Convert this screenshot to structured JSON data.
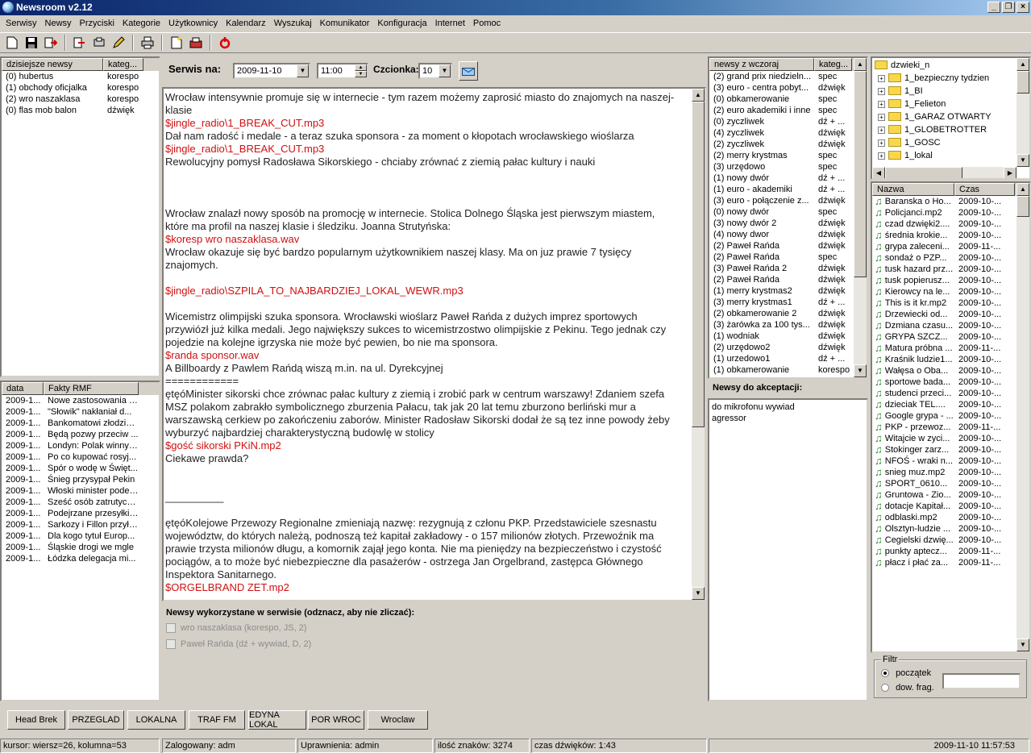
{
  "window": {
    "title": "Newsroom v2.12"
  },
  "menu": [
    "Serwisy",
    "Newsy",
    "Przyciski",
    "Kategorie",
    "Użytkownicy",
    "Kalendarz",
    "Wyszukaj",
    "Komunikator",
    "Konfiguracja",
    "Internet",
    "Pomoc"
  ],
  "today_news": {
    "headers": [
      "dzisiejsze newsy",
      "kateg..."
    ],
    "rows": [
      [
        "(0) hubertus",
        "korespo"
      ],
      [
        "(1) obchody oficjalka",
        "korespo"
      ],
      [
        "(2) wro naszaklasa",
        "korespo"
      ],
      [
        "(0) flas mob balon",
        "dźwięk"
      ]
    ]
  },
  "facts": {
    "headers": [
      "data",
      "Fakty RMF"
    ],
    "rows": [
      [
        "2009-1...",
        "Nowe zastosowania s..."
      ],
      [
        "2009-1...",
        "\"Słowik\" nakłaniał d..."
      ],
      [
        "2009-1...",
        "Bankomatowi złodziej..."
      ],
      [
        "2009-1...",
        "Będą pozwy przeciw ..."
      ],
      [
        "2009-1...",
        "Londyn: Polak winny ..."
      ],
      [
        "2009-1...",
        "Po co kupować rosyj..."
      ],
      [
        "2009-1...",
        "Spór o wodę w Święt..."
      ],
      [
        "2009-1...",
        "Śnieg przysypał Pekin"
      ],
      [
        "2009-1...",
        "Włoski minister podej..."
      ],
      [
        "2009-1...",
        "Sześć osób zatrutych..."
      ],
      [
        "2009-1...",
        "Podejrzane przesyłki ..."
      ],
      [
        "2009-1...",
        "Sarkozy i Fillon przyła..."
      ],
      [
        "2009-1...",
        "Dla kogo tytuł Europ..."
      ],
      [
        "2009-1...",
        "Śląskie drogi we mgle"
      ],
      [
        "2009-1...",
        "Łódzka delegacja mi..."
      ]
    ]
  },
  "service": {
    "label": "Serwis na:",
    "date": "2009-11-10",
    "time": "11:00",
    "font_label": "Czcionka:",
    "font_size": "10"
  },
  "editor_lines": [
    {
      "t": "Wrocław intensywnie promuje się w internecie - tym razem możemy zaprosić miasto do znajomych na naszej-",
      "red": false
    },
    {
      "t": "klasie",
      "red": false
    },
    {
      "t": "$jingle_radio\\1_BREAK_CUT.mp3",
      "red": true
    },
    {
      "t": "Dał nam radość i medale - a teraz szuka sponsora - za moment o kłopotach wrocławskiego wioślarza",
      "red": false
    },
    {
      "t": "$jingle_radio\\1_BREAK_CUT.mp3",
      "red": true
    },
    {
      "t": "Rewolucyjny pomysł Radosława Sikorskiego - chciaby zrównać z ziemią pałac kultury i nauki",
      "red": false
    },
    {
      "t": "",
      "red": false
    },
    {
      "t": "",
      "red": false
    },
    {
      "t": "",
      "red": false
    },
    {
      "t": "Wrocław znalazł nowy sposób na promocję w internecie. Stolica Dolnego Śląska jest pierwszym miastem,",
      "red": false
    },
    {
      "t": "które ma profil na naszej klasie i śledziku. Joanna Strutyńska:",
      "red": false
    },
    {
      "t": "$koresp wro naszaklasa.wav",
      "red": true
    },
    {
      "t": "Wrocław okazuje się być bardzo popularnym użytkownikiem naszej klasy. Ma on juz prawie 7 tysięcy",
      "red": false
    },
    {
      "t": "znajomych.",
      "red": false
    },
    {
      "t": "",
      "red": false
    },
    {
      "t": "$jingle_radio\\SZPILA_TO_NAJBARDZIEJ_LOKAL_WEWR.mp3",
      "red": true
    },
    {
      "t": "",
      "red": false
    },
    {
      "t": "Wicemistrz olimpijski szuka sponsora. Wrocławski wioślarz Paweł Rańda z dużych imprez sportowych",
      "red": false
    },
    {
      "t": "przywiózł już kilka medali. Jego największy sukces to wicemistrzostwo olimpijskie z Pekinu. Tego jednak czy",
      "red": false
    },
    {
      "t": "pojedzie na kolejne igrzyska nie może być pewien, bo nie ma sponsora.",
      "red": false
    },
    {
      "t": "$randa sponsor.wav",
      "red": true
    },
    {
      "t": "A Billboardy z Pawlem Rańdą wiszą m.in. na ul. Dyrekcyjnej",
      "red": false
    },
    {
      "t": "============",
      "red": false
    },
    {
      "t": "ętęóMinister sikorski chce zrównac pałac kultury z ziemią i zrobić park w centrum warszawy! Zdaniem szefa",
      "red": false
    },
    {
      "t": "MSZ polakom zabrakło symbolicznego zburzenia Pałacu, tak jak 20 lat temu zburzono berliński mur a",
      "red": false
    },
    {
      "t": "warszawską cerkiew po zakończeniu zaborów. Minister Radosław Sikorski dodał że są tez inne powody żeby",
      "red": false
    },
    {
      "t": "wyburzyć najbardziej charakterystyczną budowlę w stolicy",
      "red": false
    },
    {
      "t": "$gość sikorski PKiN.mp2",
      "red": true
    },
    {
      "t": "Ciekawe prawda?",
      "red": false
    },
    {
      "t": "",
      "red": false
    },
    {
      "t": "",
      "red": false
    },
    {
      "t": "__________",
      "red": false
    },
    {
      "t": "",
      "red": false
    },
    {
      "t": "ętęóKolejowe Przewozy Regionalne zmieniają nazwę: rezygnują z członu PKP. Przedstawiciele szesnastu",
      "red": false
    },
    {
      "t": "województw, do których należą, podnoszą też kapitał zakładowy - o 157 milionów złotych. Przewoźnik ma",
      "red": false
    },
    {
      "t": "prawie trzysta milionów długu, a komornik zajął jego konta. Nie ma pieniędzy na bezpieczeństwo i czystość",
      "red": false
    },
    {
      "t": "pociągów, a to może być niebezpieczne dla pasażerów - ostrzega Jan Orgelbrand, zastępca Głównego",
      "red": false
    },
    {
      "t": "Inspektora Sanitarnego.",
      "red": false
    },
    {
      "t": "$ORGELBRAND ZET.mp2",
      "red": true
    }
  ],
  "used_news": {
    "title": "Newsy wykorzystane w serwisie (odznacz, aby nie zliczać):",
    "items": [
      "wro naszaklasa (korespo, JS, 2)",
      "Paweł Rańda (dź + wywiad, D, 2)"
    ]
  },
  "yesterday": {
    "headers": [
      "newsy z wczoraj",
      "kateg..."
    ],
    "rows": [
      [
        "(2) grand prix niedzieln...",
        "spec"
      ],
      [
        "(3) euro - centra pobyt...",
        "dźwięk"
      ],
      [
        "(0) obkamerowanie",
        "spec"
      ],
      [
        "(2) euro akademiki i inne",
        "spec"
      ],
      [
        "(0) zyczliwek",
        "dź + ..."
      ],
      [
        "(4) zyczliwek",
        "dźwięk"
      ],
      [
        "(2) zyczliwek",
        "dźwięk"
      ],
      [
        "(2) merry krystmas",
        "spec"
      ],
      [
        "(3) urzędowo",
        "spec"
      ],
      [
        "(1) nowy dwór",
        "dź + ..."
      ],
      [
        "(1) euro - akademiki",
        "dź + ..."
      ],
      [
        "(3) euro - połączenie z...",
        "dźwięk"
      ],
      [
        "(0) nowy dwór",
        "spec"
      ],
      [
        "(3) nowy dwór 2",
        "dźwięk"
      ],
      [
        "(4) nowy dwor",
        "dźwięk"
      ],
      [
        "(2) Paweł Rańda",
        "dźwięk"
      ],
      [
        "(2) Paweł Rańda",
        "spec"
      ],
      [
        "(3) Paweł Rańda 2",
        "dźwięk"
      ],
      [
        "(2) Paweł Rańda",
        "dźwięk"
      ],
      [
        "(1) merry krystmas2",
        "dźwięk"
      ],
      [
        "(3) merry krystmas1",
        "dź + ..."
      ],
      [
        "(2) obkamerowanie 2",
        "dźwięk"
      ],
      [
        "(3) żarówka za 100 tys...",
        "dźwięk"
      ],
      [
        "(1) wodniak",
        "dźwięk"
      ],
      [
        "(2) urzędowo2",
        "dźwięk"
      ],
      [
        "(1) urzedowo1",
        "dź + ..."
      ],
      [
        "(1) obkamerowanie",
        "korespo"
      ]
    ]
  },
  "pending": {
    "title": "Newsy do akceptacji:",
    "items": [
      "do mikrofonu wywiad",
      "agressor"
    ]
  },
  "tree": {
    "root": "dzwieki_n",
    "items": [
      "1_bezpieczny tydzien",
      "1_BI",
      "1_Felieton",
      "1_GARAZ OTWARTY",
      "1_GLOBETROTTER",
      "1_GOSC",
      "1_lokal"
    ]
  },
  "files": {
    "headers": [
      "Nazwa",
      "Czas"
    ],
    "rows": [
      [
        "Baranska o Ho...",
        "2009-10-..."
      ],
      [
        "Policjanci.mp2",
        "2009-10-..."
      ],
      [
        "czad dzwięki2....",
        "2009-10-..."
      ],
      [
        "średnia krokie...",
        "2009-10-..."
      ],
      [
        "grypa zaleceni...",
        "2009-11-..."
      ],
      [
        "sondaż o PZP...",
        "2009-10-..."
      ],
      [
        "tusk hazard prz...",
        "2009-10-..."
      ],
      [
        "tusk popierusz...",
        "2009-10-..."
      ],
      [
        "Kierowcy na le...",
        "2009-10-..."
      ],
      [
        "This is it kr.mp2",
        "2009-10-..."
      ],
      [
        "Drzewiecki od...",
        "2009-10-..."
      ],
      [
        "Dzmiana czasu...",
        "2009-10-..."
      ],
      [
        "GRYPA SZCZ...",
        "2009-10-..."
      ],
      [
        "Matura próbna ...",
        "2009-11-..."
      ],
      [
        "Kraśnik ludzie1...",
        "2009-10-..."
      ],
      [
        "Wałęsa o Oba...",
        "2009-10-..."
      ],
      [
        "sportowe bada...",
        "2009-10-..."
      ],
      [
        "studenci przeci...",
        "2009-10-..."
      ],
      [
        "dzieciak TEL....",
        "2009-10-..."
      ],
      [
        "Google grypa - ...",
        "2009-10-..."
      ],
      [
        "PKP - przewoz...",
        "2009-11-..."
      ],
      [
        "Witajcie w zyci...",
        "2009-10-..."
      ],
      [
        "Stokinger zarz...",
        "2009-10-..."
      ],
      [
        "NFOŚ - wraki n...",
        "2009-10-..."
      ],
      [
        "snieg muz.mp2",
        "2009-10-..."
      ],
      [
        "SPORT_0610...",
        "2009-10-..."
      ],
      [
        "Gruntowa - Zio...",
        "2009-10-..."
      ],
      [
        "dotacje Kapitał...",
        "2009-10-..."
      ],
      [
        "odblaski.mp2",
        "2009-10-..."
      ],
      [
        "Olsztyn-ludzie ...",
        "2009-10-..."
      ],
      [
        "Cegielski dzwię...",
        "2009-10-..."
      ],
      [
        "punkty aptecz...",
        "2009-11-..."
      ],
      [
        "płacz i płać za...",
        "2009-11-..."
      ]
    ]
  },
  "filter": {
    "title": "Filtr",
    "opt1": "początek",
    "opt2": "dow. frag."
  },
  "buttons": [
    "Head Brek",
    "PRZEGLAD",
    "LOKALNA",
    "TRAF FM",
    "EDYNA LOKAL",
    "POR WROC",
    "Wroclaw"
  ],
  "status": {
    "cursor": "kursor: wiersz=26, kolumna=53",
    "user": "Zalogowany: adm",
    "rights": "Uprawnienia: admin",
    "chars": "ilość znaków: 3274",
    "sound": "czas dźwięków: 1:43",
    "datetime": "2009-11-10 11:57:53"
  }
}
